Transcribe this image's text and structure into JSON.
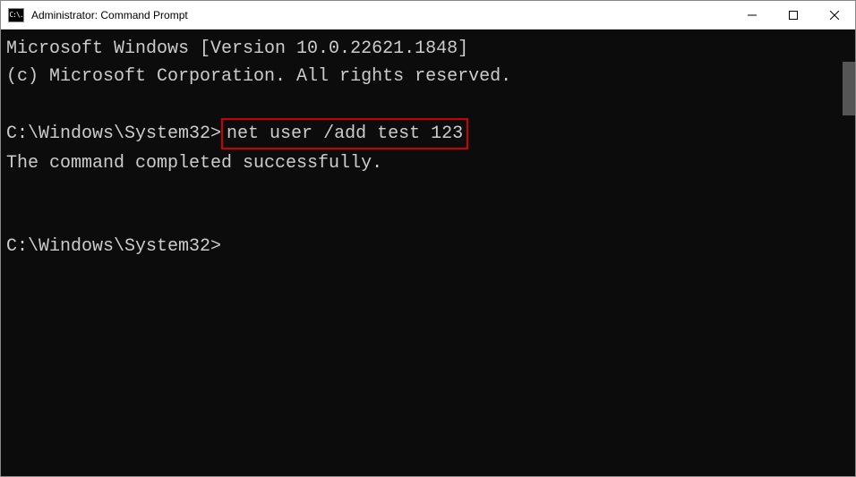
{
  "window": {
    "title": "Administrator: Command Prompt",
    "icon_text": "C:\\."
  },
  "terminal": {
    "line1": "Microsoft Windows [Version 10.0.22621.1848]",
    "line2": "(c) Microsoft Corporation. All rights reserved.",
    "prompt1": "C:\\Windows\\System32>",
    "command1": "net user /add test 123",
    "result1": "The command completed successfully.",
    "prompt2": "C:\\Windows\\System32>"
  }
}
